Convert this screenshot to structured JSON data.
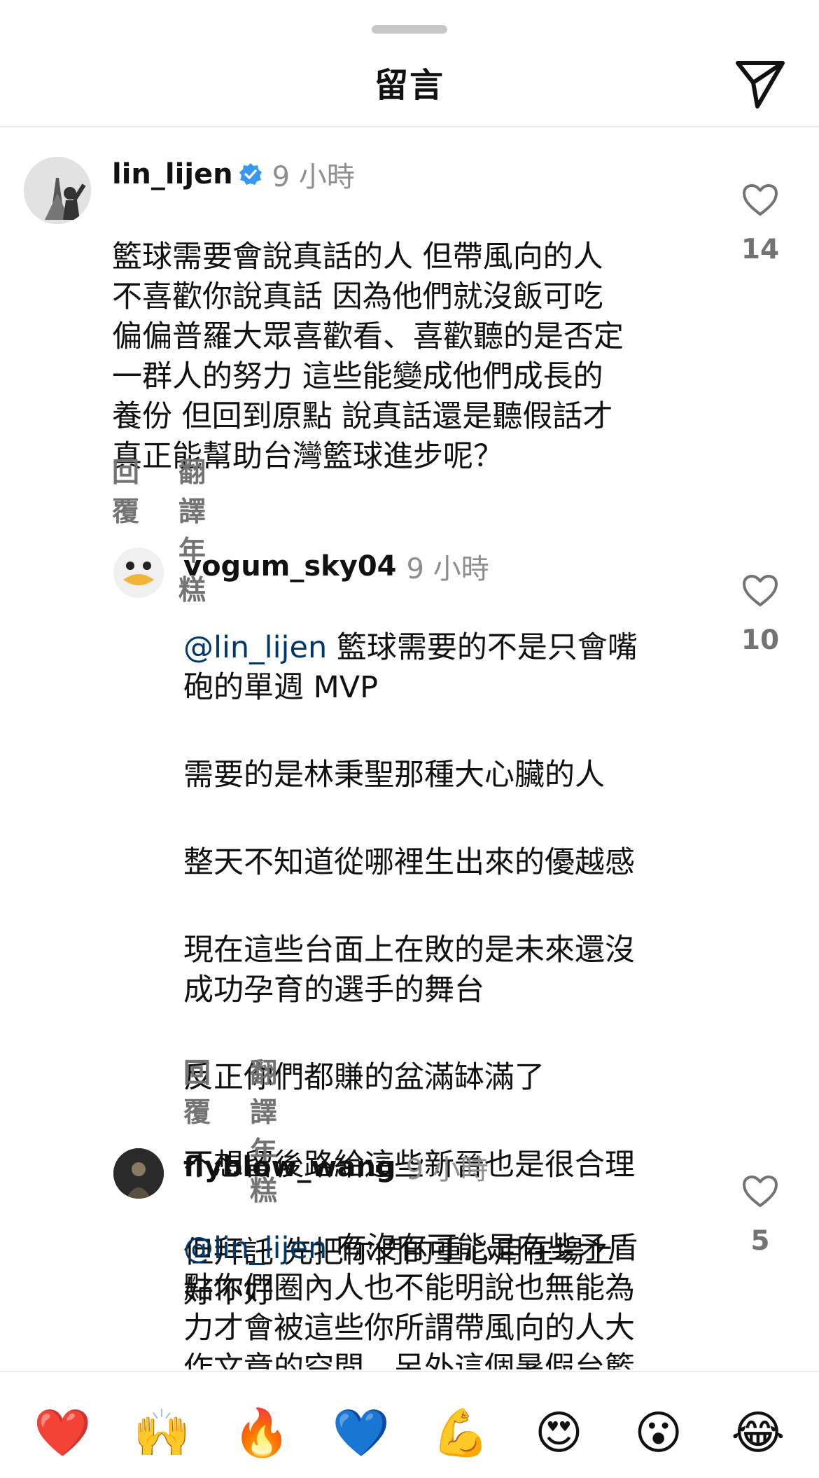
{
  "header": {
    "title": "留言"
  },
  "comments": [
    {
      "username": "lin_lijen",
      "verified": true,
      "time": "9 小時",
      "mention": "",
      "paragraphs": [
        "籃球需要會說真話的人 但帶風向的人\n不喜歡你說真話 因為他們就沒飯可吃\n偏偏普羅大眾喜歡看、喜歡聽的是否定\n一群人的努力 這些能變成他們成長的\n養份 但回到原點 說真話還是聽假話才\n真正能幫助台灣籃球進步呢？"
      ],
      "reply_label": "回覆",
      "translate_label": "翻譯年糕",
      "likes": "14"
    },
    {
      "username": "vogum_sky04",
      "verified": false,
      "time": "9 小時",
      "mention": "@lin_lijen",
      "paragraphs": [
        " 籃球需要的不是只會嘴\n砲的單週 MVP",
        "需要的是林秉聖那種大心臟的人",
        "整天不知道從哪裡生出來的優越感",
        "現在這些台面上在敗的是未來還沒\n成功孕育的選手的舞台",
        "反正你們都賺的盆滿缽滿了",
        "不想留後路給這些新晉也是很合理",
        "但拜託 先把你們的重心用在場上\n好不好"
      ],
      "reply_label": "回覆",
      "translate_label": "翻譯年糕",
      "likes": "10"
    },
    {
      "username": "flyblow_wang",
      "verified": false,
      "time": "9 小時",
      "mention": "@lin_lijen",
      "paragraphs": [
        " 有沒有可能是有些矛盾\n點你們圈內人也不能明說也無能為\n力才會被這些你所謂帶風向的人大\n作文章的空間。另外這個暑假台籃\n的負面新聞又上了另一個高度，到"
      ],
      "likes": "5"
    }
  ],
  "emoji_bar": [
    "❤️",
    "🙌",
    "🔥",
    "💙",
    "💪",
    "😍",
    "😮",
    "😂"
  ],
  "colors": {
    "mention": "#00376b",
    "muted": "#737373",
    "verified": "#3897f0"
  }
}
